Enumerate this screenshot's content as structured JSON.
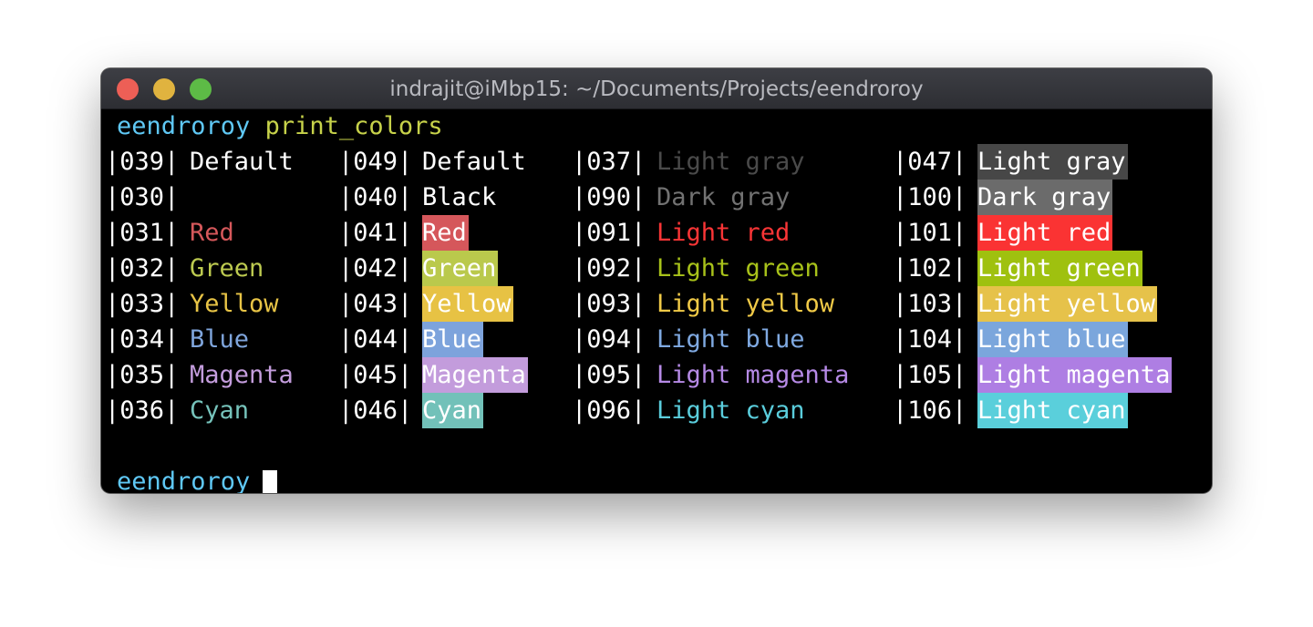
{
  "window": {
    "title": "indrajit@iMbp15: ~/Documents/Projects/eendroroy"
  },
  "terminal": {
    "prompt": "eendroroy",
    "command": "print_colors",
    "rows": [
      {
        "fg": {
          "code": "|039|",
          "label": "Default",
          "color": "#ffffff"
        },
        "bg": {
          "code": "|049|",
          "label": "Default",
          "color": "#ffffff",
          "background": ""
        },
        "lfg": {
          "code": "|037|",
          "label": "Light gray",
          "color": "#4a4a4a"
        },
        "lbg": {
          "code": "|047|",
          "label": "Light gray",
          "color": "#ffffff",
          "background": "#474747"
        }
      },
      {
        "fg": {
          "code": "|030|",
          "label": "",
          "color": "#000000"
        },
        "bg": {
          "code": "|040|",
          "label": "Black",
          "color": "#ffffff",
          "background": "#000000"
        },
        "lfg": {
          "code": "|090|",
          "label": "Dark gray",
          "color": "#727272"
        },
        "lbg": {
          "code": "|100|",
          "label": "Dark gray",
          "color": "#ffffff",
          "background": "#6b6b6b"
        }
      },
      {
        "fg": {
          "code": "|031|",
          "label": "Red",
          "color": "#d6585b"
        },
        "bg": {
          "code": "|041|",
          "label": "Red",
          "color": "#ffffff",
          "background": "#d5575b"
        },
        "lfg": {
          "code": "|091|",
          "label": "Light red",
          "color": "#fa3536"
        },
        "lbg": {
          "code": "|101|",
          "label": "Light red",
          "color": "#ffffff",
          "background": "#fa3333"
        }
      },
      {
        "fg": {
          "code": "|032|",
          "label": "Green",
          "color": "#bdca50"
        },
        "bg": {
          "code": "|042|",
          "label": "Green",
          "color": "#ffffff",
          "background": "#bac94c"
        },
        "lfg": {
          "code": "|092|",
          "label": "Light green",
          "color": "#a8c21a"
        },
        "lbg": {
          "code": "|102|",
          "label": "Light green",
          "color": "#ffffff",
          "background": "#9fc10f"
        }
      },
      {
        "fg": {
          "code": "|033|",
          "label": "Yellow",
          "color": "#e8c446"
        },
        "bg": {
          "code": "|043|",
          "label": "Yellow",
          "color": "#ffffff",
          "background": "#e7c244"
        },
        "lfg": {
          "code": "|093|",
          "label": "Light yellow",
          "color": "#f1ca47"
        },
        "lbg": {
          "code": "|103|",
          "label": "Light yellow",
          "color": "#ffffff",
          "background": "#e6c24a"
        }
      },
      {
        "fg": {
          "code": "|034|",
          "label": "Blue",
          "color": "#7fa5dc"
        },
        "bg": {
          "code": "|044|",
          "label": "Blue",
          "color": "#ffffff",
          "background": "#7da3dc"
        },
        "lfg": {
          "code": "|094|",
          "label": "Light blue",
          "color": "#7fa9e1"
        },
        "lbg": {
          "code": "|104|",
          "label": "Light blue",
          "color": "#ffffff",
          "background": "#7ba6dc"
        }
      },
      {
        "fg": {
          "code": "|035|",
          "label": "Magenta",
          "color": "#c49ddd"
        },
        "bg": {
          "code": "|045|",
          "label": "Magenta",
          "color": "#ffffff",
          "background": "#c39cdc"
        },
        "lfg": {
          "code": "|095|",
          "label": "Light magenta",
          "color": "#b68ae6"
        },
        "lbg": {
          "code": "|105|",
          "label": "Light magenta",
          "color": "#ffffff",
          "background": "#ae7ee3"
        }
      },
      {
        "fg": {
          "code": "|036|",
          "label": "Cyan",
          "color": "#76c3bb"
        },
        "bg": {
          "code": "|046|",
          "label": "Cyan",
          "color": "#ffffff",
          "background": "#72c1b9"
        },
        "lfg": {
          "code": "|096|",
          "label": "Light cyan",
          "color": "#5acddc"
        },
        "lbg": {
          "code": "|106|",
          "label": "Light cyan",
          "color": "#ffffff",
          "background": "#5acfdb"
        }
      }
    ],
    "prompt2": "eendroroy"
  }
}
